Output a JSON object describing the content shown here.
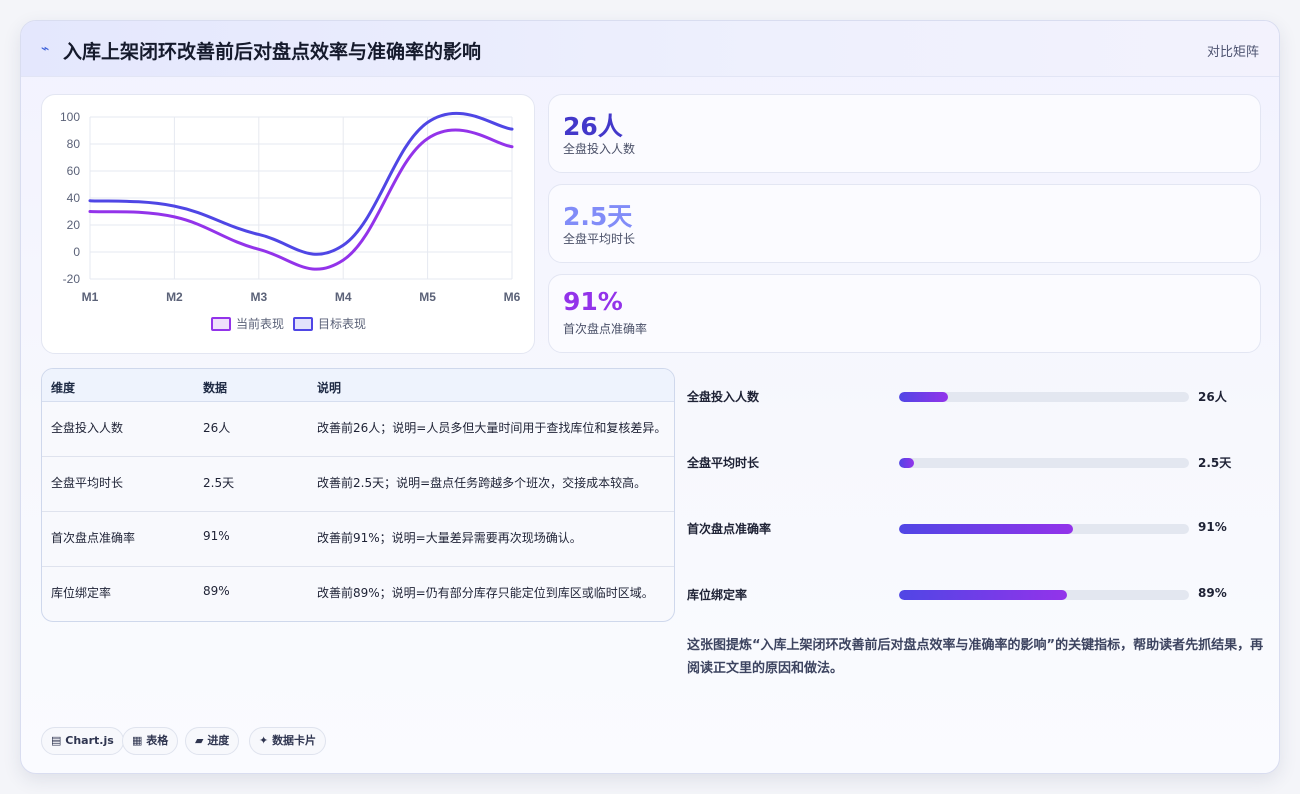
{
  "header": {
    "icon": "bolt-icon",
    "title": "入库上架闭环改善前后对盘点效率与准确率的影响",
    "tag": "对比矩阵"
  },
  "chart_data": {
    "type": "line",
    "categories": [
      "M1",
      "M2",
      "M3",
      "M4",
      "M5",
      "M6"
    ],
    "ylim": [
      -20,
      100
    ],
    "yticks": [
      -20,
      0,
      20,
      40,
      60,
      80,
      100
    ],
    "grid": true,
    "legend_position": "bottom",
    "series": [
      {
        "name": "当前表现",
        "color": "#9333ea",
        "values": [
          30,
          26,
          2,
          -6,
          84,
          78
        ]
      },
      {
        "name": "目标表现",
        "color": "#4f46e5",
        "values": [
          38,
          34,
          13,
          5,
          96,
          91
        ]
      }
    ]
  },
  "kpis": [
    {
      "value": "26人",
      "label": "全盘投入人数",
      "color": "#4338ca"
    },
    {
      "value": "2.5天",
      "label": "全盘平均时长",
      "color": "#818cf8"
    },
    {
      "value": "91%",
      "label": "首次盘点准确率",
      "color": "#9333ea"
    }
  ],
  "table": {
    "headers": [
      "维度",
      "数据",
      "说明"
    ],
    "rows": [
      [
        "全盘投入人数",
        "26人",
        "改善前26人；说明=人员多但大量时间用于查找库位和复核差异。"
      ],
      [
        "全盘平均时长",
        "2.5天",
        "改善前2.5天；说明=盘点任务跨越多个班次，交接成本较高。"
      ],
      [
        "首次盘点准确率",
        "91%",
        "改善前91%；说明=大量差异需要再次现场确认。"
      ],
      [
        "库位绑定率",
        "89%",
        "改善前89%；说明=仍有部分库存只能定位到库区或临时区域。"
      ]
    ]
  },
  "progress": [
    {
      "label": "全盘投入人数",
      "value": "26人",
      "fraction": 0.17
    },
    {
      "label": "全盘平均时长",
      "value": "2.5天",
      "fraction": 0.05
    },
    {
      "label": "首次盘点准确率",
      "value": "91%",
      "fraction": 0.6
    },
    {
      "label": "库位绑定率",
      "value": "89%",
      "fraction": 0.58
    }
  ],
  "summary": "这张图提炼“入库上架闭环改善前后对盘点效率与准确率的影响”的关键指标，帮助读者先抓结果，再阅读正文里的原因和做法。",
  "chips": [
    {
      "icon": "chart-icon",
      "glyph": "▤",
      "label": "Chart.js"
    },
    {
      "icon": "table-icon",
      "glyph": "▦",
      "label": "表格"
    },
    {
      "icon": "progress-icon",
      "glyph": "▰",
      "label": "进度"
    },
    {
      "icon": "sparkle-icon",
      "glyph": "✦",
      "label": "数据卡片"
    }
  ]
}
